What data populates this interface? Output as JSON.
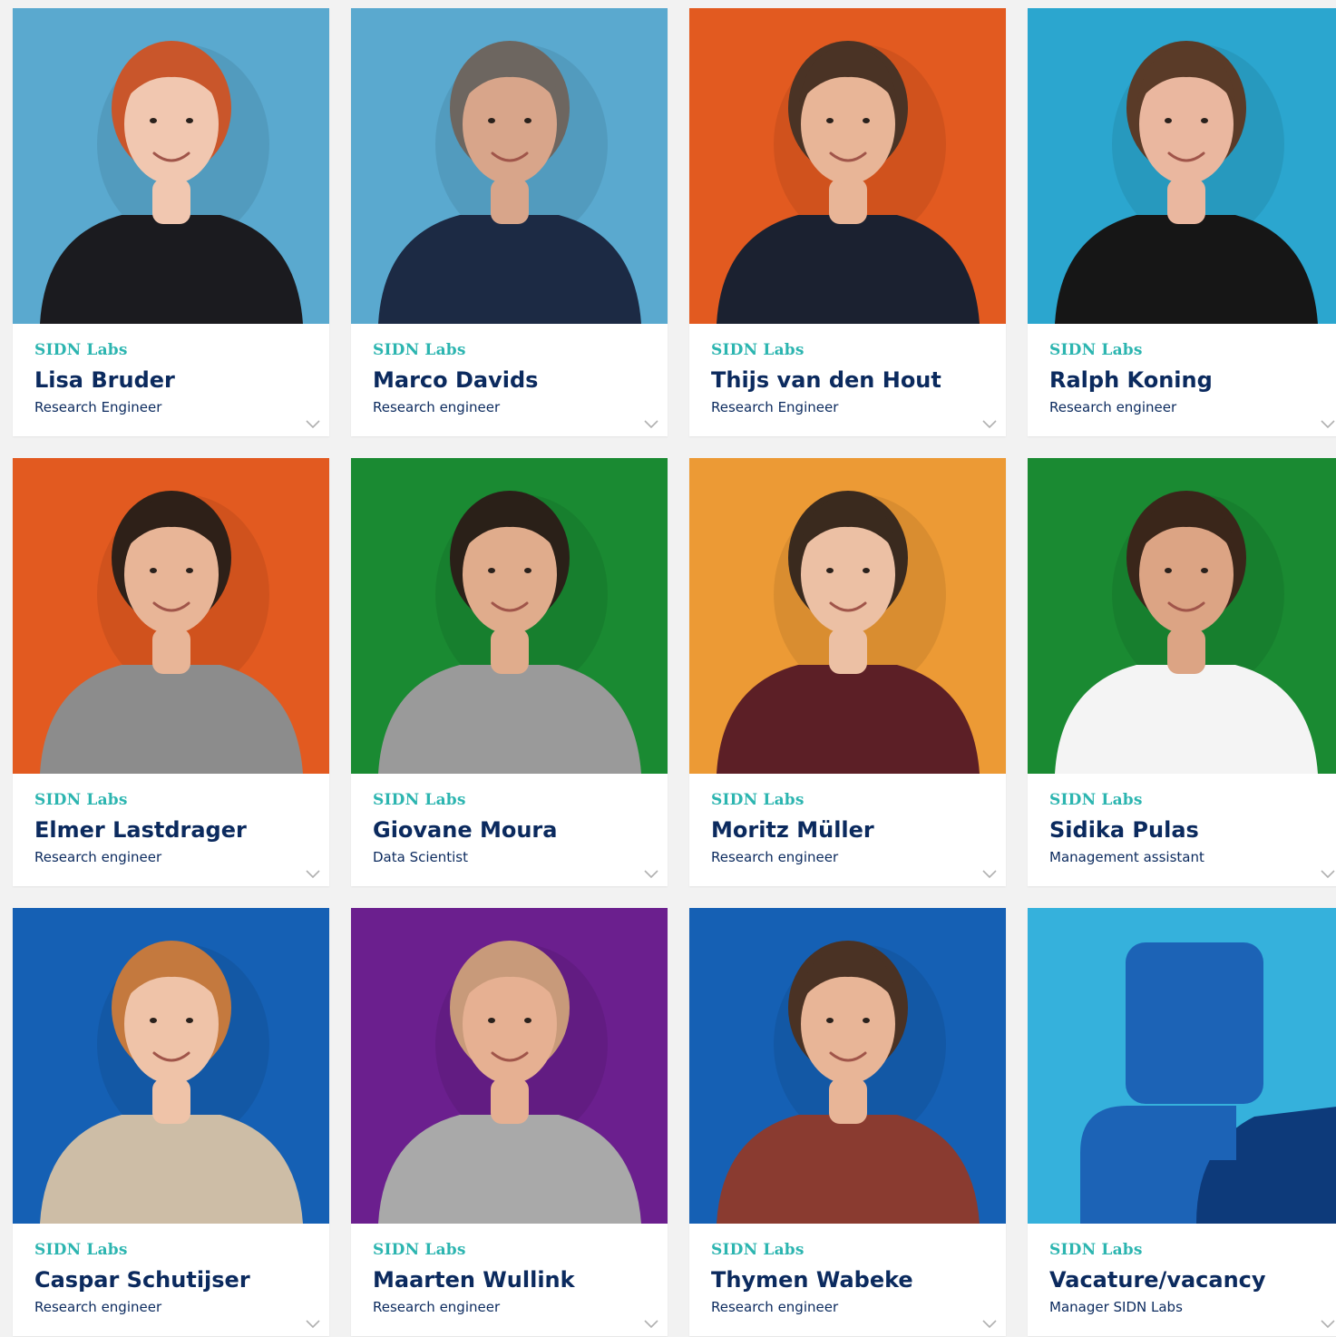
{
  "people": [
    {
      "org": "SIDN Labs",
      "name": "Lisa Bruder",
      "role": "Research Engineer",
      "bg": "#5aa9cf",
      "hair": "#c9562b",
      "top": "#1b1b1f",
      "skin": "#f1c7b0"
    },
    {
      "org": "SIDN Labs",
      "name": "Marco Davids",
      "role": "Research engineer",
      "bg": "#5aa9cf",
      "hair": "#6d6660",
      "top": "#1c2a44",
      "skin": "#d8a58a"
    },
    {
      "org": "SIDN Labs",
      "name": "Thijs van den Hout",
      "role": "Research Engineer",
      "bg": "#e25a20",
      "hair": "#4a3325",
      "top": "#1b2130",
      "skin": "#e8b597"
    },
    {
      "org": "SIDN Labs",
      "name": "Ralph Koning",
      "role": "Research engineer",
      "bg": "#2ba6cf",
      "hair": "#5a3b28",
      "top": "#161616",
      "skin": "#eab79f"
    },
    {
      "org": "SIDN Labs",
      "name": "Elmer Lastdrager",
      "role": "Research engineer",
      "bg": "#e25a20",
      "hair": "#2e2018",
      "top": "#8c8c8c",
      "skin": "#e8b597"
    },
    {
      "org": "SIDN Labs",
      "name": "Giovane Moura",
      "role": "Data Scientist",
      "bg": "#1a8a32",
      "hair": "#2a2018",
      "top": "#9a9a9a",
      "skin": "#e0ac8c"
    },
    {
      "org": "SIDN Labs",
      "name": "Moritz Müller",
      "role": "Research engineer",
      "bg": "#ec9a35",
      "hair": "#3a2a1e",
      "top": "#5c1f26",
      "skin": "#ecc0a4"
    },
    {
      "org": "SIDN Labs",
      "name": "Sidika Pulas",
      "role": "Management assistant",
      "bg": "#1a8a32",
      "hair": "#3a261a",
      "top": "#f4f4f4",
      "skin": "#dca484"
    },
    {
      "org": "SIDN Labs",
      "name": "Caspar Schutijser",
      "role": "Research engineer",
      "bg": "#1560b4",
      "hair": "#c4793e",
      "top": "#cdbda6",
      "skin": "#efc3a8"
    },
    {
      "org": "SIDN Labs",
      "name": "Maarten Wullink",
      "role": "Research engineer",
      "bg": "#6b1f8e",
      "hair": "#c89a7a",
      "top": "#a9a9a9",
      "skin": "#e6b092"
    },
    {
      "org": "SIDN Labs",
      "name": "Thymen Wabeke",
      "role": "Research engineer",
      "bg": "#1560b4",
      "hair": "#4a3224",
      "top": "#8a3b30",
      "skin": "#e8b597"
    },
    {
      "org": "SIDN Labs",
      "name": "Vacature/vacancy",
      "role": "Manager SIDN Labs",
      "bg": "#35b1dc",
      "placeholder": true
    }
  ],
  "colors": {
    "org": "#2cb5b0",
    "name": "#0b2a5e",
    "page_bg": "#f2f2f2"
  },
  "icons": {
    "expand": "chevron-down-icon",
    "photo": "portrait-photo"
  }
}
